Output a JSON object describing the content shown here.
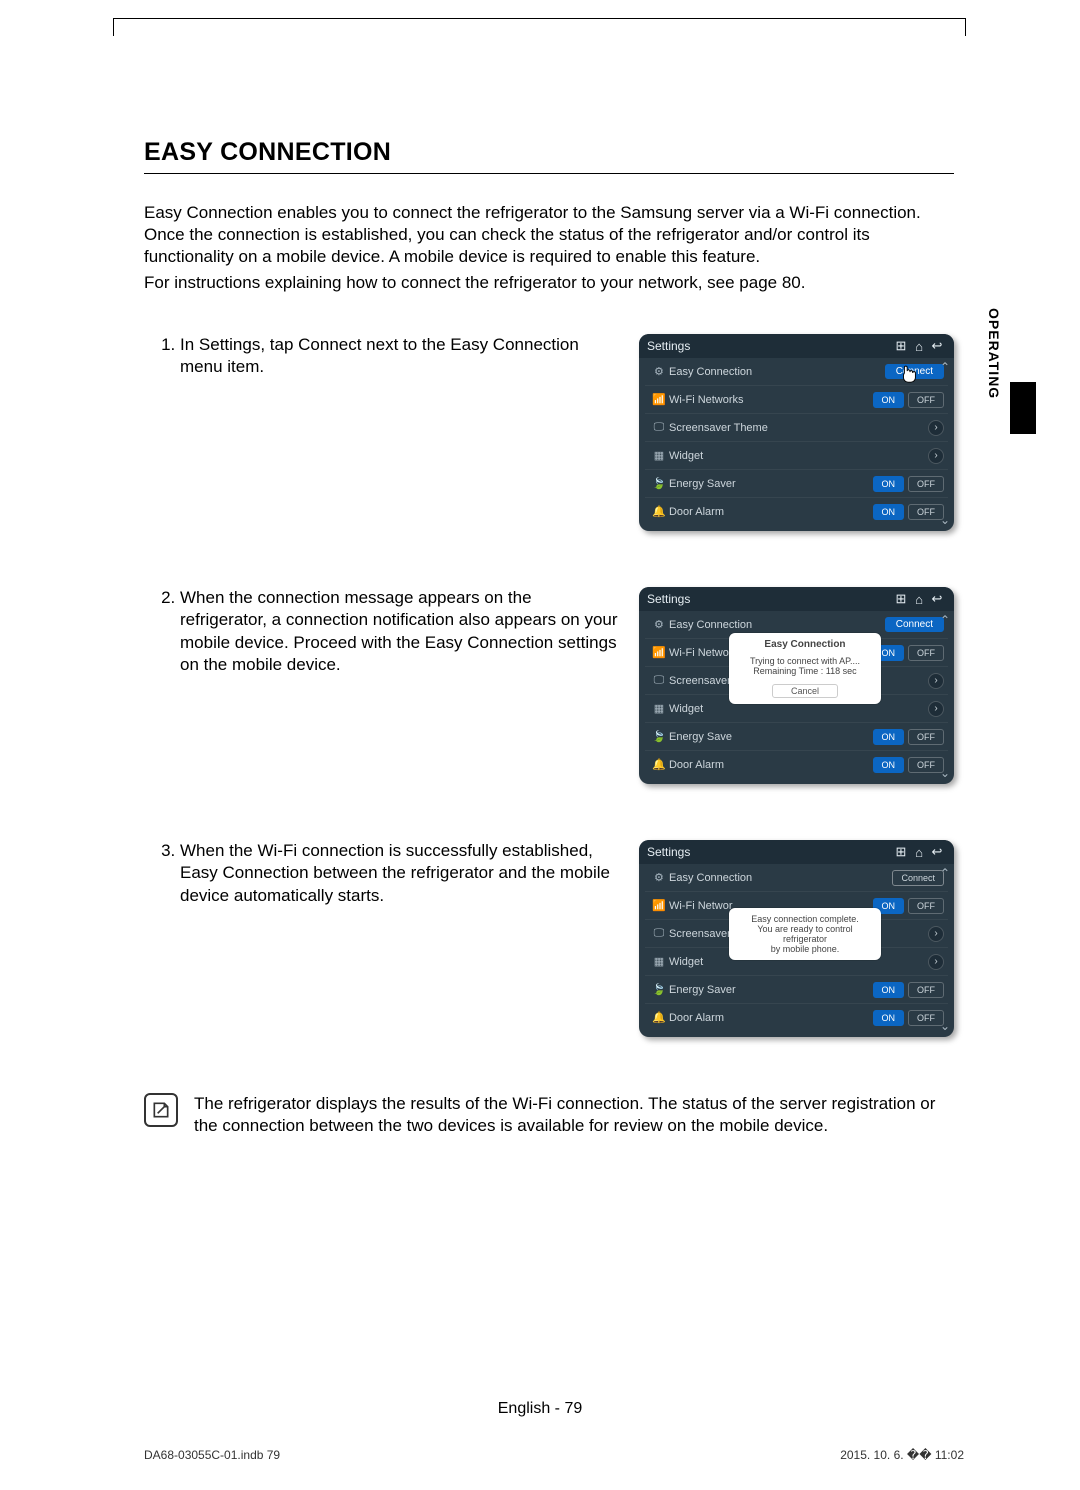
{
  "page": {
    "title": "Easy Connection",
    "intro_1": "Easy Connection enables you to connect the refrigerator to the Samsung server via a Wi-Fi connection. Once the connection is established, you can check the status of the refrigerator and/or control its functionality on a mobile device. A mobile device is required to enable this feature.",
    "intro_2": "For instructions explaining how to connect the refrigerator to your network, see page 80.",
    "section_tab": "OPERATING",
    "footer": "English - 79",
    "print_file": "DA68-03055C-01.indb   79",
    "print_date": "2015. 10. 6.   �� 11:02"
  },
  "steps": {
    "s1": "In Settings, tap Connect next to the Easy Connection menu item.",
    "s2": "When the connection message appears on the refrigerator, a connection notification also appears on your mobile device. Proceed with the Easy Connection settings on the mobile device.",
    "s3": "When the Wi-Fi connection is successfully established, Easy Connection between the refrigerator and the mobile device automatically starts."
  },
  "note": "The refrigerator displays the results of the Wi-Fi connection. The status of the server registration or the connection between the two devices is available for review on the mobile device.",
  "ui": {
    "header": "Settings",
    "rows": {
      "easy_connection": "Easy Connection",
      "wifi": "Wi-Fi Networks",
      "wifi_short": "Wi-Fi Networ",
      "screensaver": "Screensaver Theme",
      "screensaver_short": "Screensaver",
      "widget": "Widget",
      "energy_saver": "Energy Saver",
      "energy_saver_short": "Energy Save",
      "door_alarm": "Door Alarm"
    },
    "btn": {
      "connect": "Connect",
      "on": "ON",
      "off": "OFF",
      "cancel": "Cancel"
    },
    "popup2": {
      "title": "Easy Connection",
      "line1": "Trying to connect with AP....",
      "line2": "Remaining Time : 118 sec"
    },
    "popup3": {
      "line1": "Easy connection complete.",
      "line2": "You are ready to control refrigerator",
      "line3": "by mobile phone."
    }
  }
}
